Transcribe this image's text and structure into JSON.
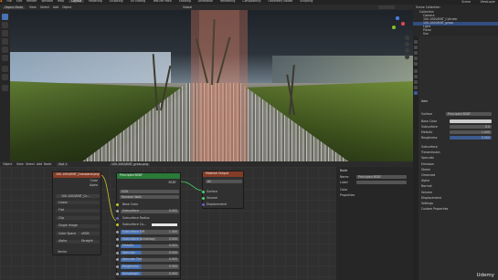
{
  "topbar": {
    "menus": [
      "File",
      "Edit",
      "Render",
      "Window",
      "Help"
    ],
    "tabs": [
      "Layout",
      "Modeling",
      "Sculpting",
      "UV Editing",
      "Texture Paint",
      "Shading",
      "Animation",
      "Rendering",
      "Compositing",
      "Geometry Nodes",
      "Scripting"
    ],
    "active_tab": "Layout",
    "scene": "Scene",
    "view_layer": "ViewLayer"
  },
  "viewport_header": {
    "mode": "Object Mode",
    "menus": [
      "View",
      "Select",
      "Add",
      "Object"
    ],
    "transform": "Global"
  },
  "outliner": {
    "title": "Scene Collection",
    "rows": [
      "Collection",
      "Camera",
      "100-1000/KNT_Cylinder",
      "100-1000/KNT_grass",
      "Light",
      "Plane",
      "Sun"
    ]
  },
  "properties": {
    "section": "Item",
    "shader": "Principled BSDF",
    "surface_label": "Surface",
    "fields": [
      "Base Color",
      "Subsurface",
      "Metallic",
      "Roughness"
    ],
    "values": [
      "0.8",
      "0.0",
      "1.000",
      "0.500"
    ],
    "subsections": [
      "Subsurface",
      "Transmission",
      "Specular",
      "Emission",
      "Sheen",
      "Clearcoat",
      "Alpha",
      "Normal",
      "Volume",
      "Displacement",
      "Settings",
      "Custom Properties"
    ]
  },
  "node_editor": {
    "header_menus": [
      "Object",
      "View",
      "Select",
      "Add",
      "Node"
    ],
    "material": "100-1000/KNT_grass.png",
    "slot": "Slot 1",
    "sidebar": {
      "labels": [
        "Node",
        "Name",
        "Label",
        "Color",
        "Properties"
      ],
      "name": "Principled BSDF"
    }
  },
  "nodes": {
    "image": {
      "title": "100-1000/KNT_Grassland.png",
      "file": "100-1000/KNT_Gr...",
      "rows": [
        [
          "Linear",
          ""
        ],
        [
          "Flat",
          ""
        ],
        [
          "Clip",
          ""
        ],
        [
          "Single Image",
          ""
        ],
        [
          "Color Space",
          "sRGB"
        ],
        [
          "Alpha",
          "Straight"
        ]
      ],
      "outputs": [
        "Color",
        "Alpha"
      ],
      "input": "Vector"
    },
    "bsdf": {
      "title": "Principled BSDF",
      "output": "BSDF",
      "dist": "GGX",
      "sss": "Random Walk",
      "rows": [
        [
          "Base Color",
          ""
        ],
        [
          "Subsurface",
          "0.000"
        ],
        [
          "Subsurface Radius",
          ""
        ],
        [
          "Subsurface Co...",
          ""
        ],
        [
          "Subsurface IOR",
          "1.400"
        ],
        [
          "Subsurface Anisotropy",
          "0.000"
        ],
        [
          "Metallic",
          "0.000"
        ],
        [
          "Specular",
          "0.500"
        ],
        [
          "Specular Tint",
          "0.000"
        ],
        [
          "Roughness",
          "0.500"
        ],
        [
          "Anisotropic",
          "0.000"
        ]
      ]
    },
    "output": {
      "title": "Material Output",
      "target": "All",
      "sockets": [
        "Surface",
        "Volume",
        "Displacement"
      ]
    }
  },
  "watermark": "Udemy"
}
